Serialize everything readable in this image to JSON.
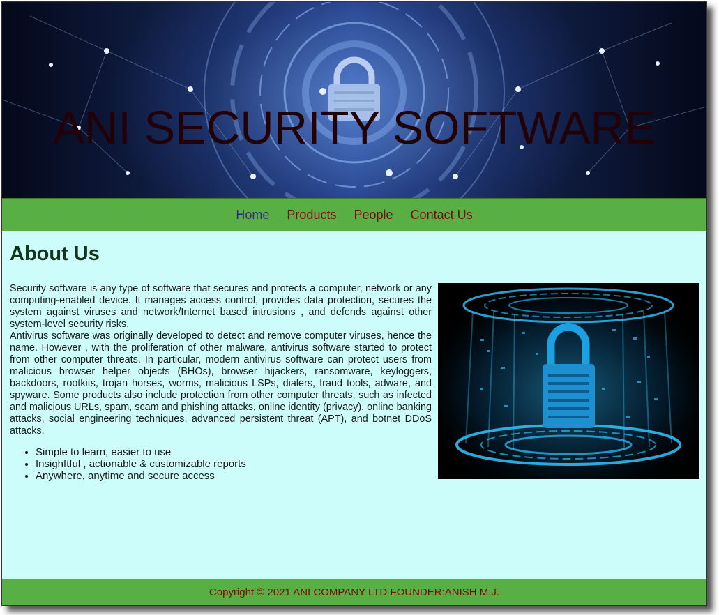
{
  "banner": {
    "title": "ANI SECURITY SOFTWARE",
    "image_icon": "padlock-circuit-icon"
  },
  "nav": {
    "items": [
      {
        "label": "Home",
        "active": true
      },
      {
        "label": "Products",
        "active": false
      },
      {
        "label": "People",
        "active": false
      },
      {
        "label": "Contact Us",
        "active": false
      }
    ]
  },
  "main": {
    "heading": "About Us",
    "paragraph1": "Security software is any type of software that secures and protects a computer, network or any computing-enabled device. It manages access control, provides data protection, secures the system against viruses and network/Internet based intrusions , and defends against other system-level security risks.",
    "paragraph2": "Antivirus software was originally developed to detect and remove computer viruses, hence the name. However , with the proliferation of other malware, antivirus software started to protect from other computer threats. In particular, modern antivirus software can protect users from malicious browser helper objects (BHOs), browser hijackers, ransomware, keyloggers, backdoors, rootkits, trojan horses, worms, malicious LSPs, dialers, fraud tools, adware, and spyware. Some products also include protection from other computer threats, such as infected and malicious URLs, spam, scam and phishing attacks, online identity (privacy), online banking attacks, social engineering techniques, advanced persistent threat (APT), and botnet DDoS attacks.",
    "features": [
      "Simple to learn, easier to use",
      "Insighftful , actionable & customizable reports",
      "Anywhere, anytime and secure access"
    ],
    "side_image_icon": "digital-padlock-icon"
  },
  "footer": {
    "text": "Copyright © 2021 ANI COMPANY LTD FOUNDER:ANISH M.J."
  },
  "colors": {
    "nav_bg": "#58b044",
    "content_bg": "#ccfdfb",
    "link": "#7a0a0a",
    "active_link": "#3a2a7a",
    "heading": "#12351c"
  }
}
